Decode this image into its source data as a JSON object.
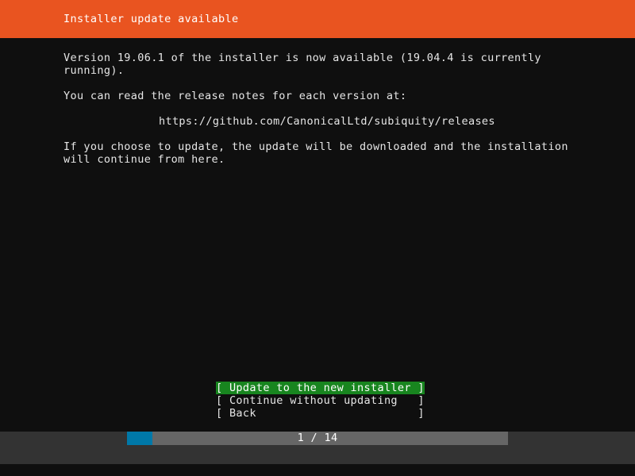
{
  "header": {
    "title": "Installer update available",
    "bg_color": "#e95420",
    "text_color": "#ffffff"
  },
  "body": {
    "bg_color": "#0f0f0f",
    "text_color": "#e6e6e6",
    "paragraphs": {
      "version": "Version 19.06.1 of the installer is now available (19.04.4 is currently running).",
      "release_notes": "You can read the release notes for each version at:",
      "url": "https://github.com/CanonicalLtd/subiquity/releases",
      "choose": "If you choose to update, the update will be downloaded and the installation will continue from here."
    }
  },
  "buttons": [
    {
      "label": "[ Update to the new installer ]",
      "text": "Update to the new installer",
      "selected": true,
      "highlight_color": "#18851f"
    },
    {
      "label": "[ Continue without updating   ]",
      "text": "Continue without updating",
      "selected": false,
      "highlight_color": ""
    },
    {
      "label": "[ Back                        ]",
      "text": "Back",
      "selected": false,
      "highlight_color": ""
    }
  ],
  "progress": {
    "label": "1 / 14",
    "current": 1,
    "total": 14,
    "percent": 7,
    "fill_color": "#0078a8",
    "track_color": "#666666",
    "footer_color": "#333333"
  }
}
